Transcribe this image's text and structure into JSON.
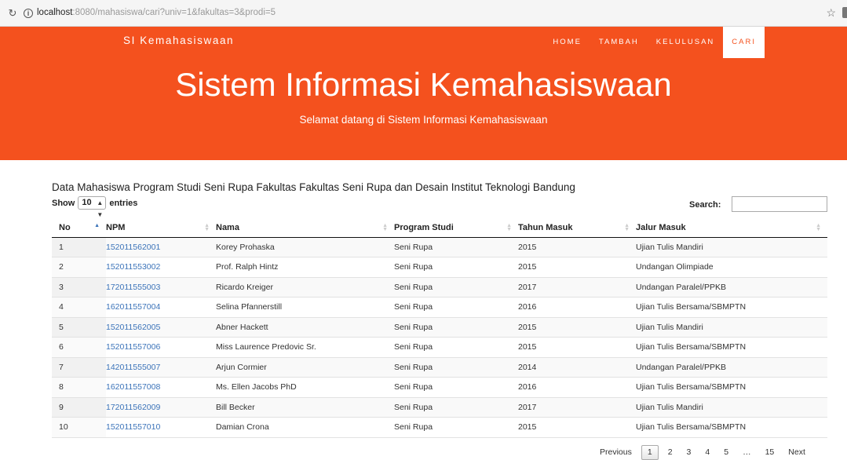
{
  "browser": {
    "url_host": "localhost",
    "url_rest": ":8080/mahasiswa/cari?univ=1&fakultas=3&prodi=5"
  },
  "header": {
    "brand": "SI Kemahasiswaan",
    "nav": [
      "HOME",
      "TAMBAH",
      "KELULUSAN",
      "CARI"
    ],
    "active_nav": "CARI",
    "title": "Sistem Informasi Kemahasiswaan",
    "subtitle": "Selamat datang di Sistem Informasi Kemahasiswaan",
    "bg_color": "#f4511e"
  },
  "content": {
    "title": "Data Mahasiswa Program Studi Seni Rupa Fakultas Fakultas Seni Rupa dan Desain Institut Teknologi Bandung",
    "show_label": "Show",
    "entries_value": "10",
    "entries_label": "entries",
    "search_label": "Search:",
    "search_value": ""
  },
  "table": {
    "columns": [
      "No",
      "NPM",
      "Nama",
      "Program Studi",
      "Tahun Masuk",
      "Jalur Masuk"
    ],
    "rows": [
      [
        "1",
        "152011562001",
        "Korey Prohaska",
        "Seni Rupa",
        "2015",
        "Ujian Tulis Mandiri"
      ],
      [
        "2",
        "152011553002",
        "Prof. Ralph Hintz",
        "Seni Rupa",
        "2015",
        "Undangan Olimpiade"
      ],
      [
        "3",
        "172011555003",
        "Ricardo Kreiger",
        "Seni Rupa",
        "2017",
        "Undangan Paralel/PPKB"
      ],
      [
        "4",
        "162011557004",
        "Selina Pfannerstill",
        "Seni Rupa",
        "2016",
        "Ujian Tulis Bersama/SBMPTN"
      ],
      [
        "5",
        "152011562005",
        "Abner Hackett",
        "Seni Rupa",
        "2015",
        "Ujian Tulis Mandiri"
      ],
      [
        "6",
        "152011557006",
        "Miss Laurence Predovic Sr.",
        "Seni Rupa",
        "2015",
        "Ujian Tulis Bersama/SBMPTN"
      ],
      [
        "7",
        "142011555007",
        "Arjun Cormier",
        "Seni Rupa",
        "2014",
        "Undangan Paralel/PPKB"
      ],
      [
        "8",
        "162011557008",
        "Ms. Ellen Jacobs PhD",
        "Seni Rupa",
        "2016",
        "Ujian Tulis Bersama/SBMPTN"
      ],
      [
        "9",
        "172011562009",
        "Bill Becker",
        "Seni Rupa",
        "2017",
        "Ujian Tulis Mandiri"
      ],
      [
        "10",
        "152011557010",
        "Damian Crona",
        "Seni Rupa",
        "2015",
        "Ujian Tulis Bersama/SBMPTN"
      ]
    ]
  },
  "pagination": {
    "previous": "Previous",
    "pages": [
      "1",
      "2",
      "3",
      "4",
      "5",
      "…",
      "15"
    ],
    "current": "1",
    "next": "Next"
  }
}
